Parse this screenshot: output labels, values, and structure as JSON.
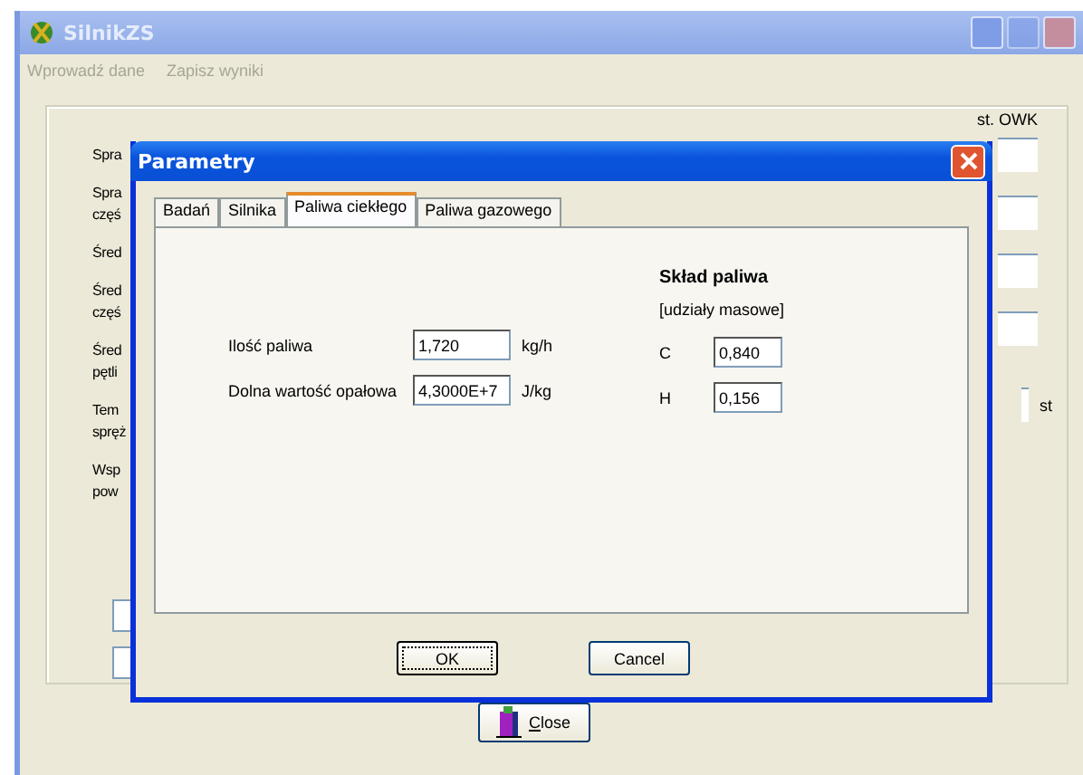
{
  "main_window": {
    "title": "SilnikZS",
    "menu": [
      {
        "label": "Wprowadź dane",
        "disabled": true
      },
      {
        "label": "Zapisz wyniki",
        "disabled": true
      }
    ],
    "labels": [
      {
        "lines": [
          "Spra"
        ]
      },
      {
        "lines": [
          "Spra",
          "częś"
        ]
      },
      {
        "lines": [
          "Śred"
        ]
      },
      {
        "lines": [
          "Śred",
          "częś"
        ]
      },
      {
        "lines": [
          "Śred",
          "pętli"
        ]
      },
      {
        "lines": [
          "Tem",
          "spręż"
        ]
      },
      {
        "lines": [
          "Wsp",
          "pow"
        ]
      }
    ],
    "unit_header": "st. OWK",
    "unit_label": "st",
    "close_button": "Close"
  },
  "dialog": {
    "title": "Parametry",
    "tabs": [
      {
        "label": "Badań",
        "selected": false
      },
      {
        "label": "Silnika",
        "selected": false
      },
      {
        "label": "Paliwa ciekłego",
        "selected": true
      },
      {
        "label": "Paliwa gazowego",
        "selected": false
      }
    ],
    "fields": [
      {
        "label": "Ilość paliwa",
        "value": "1,720",
        "unit": "kg/h"
      },
      {
        "label": "Dolna wartość opałowa",
        "value": "4,3000E+7",
        "unit": "J/kg"
      }
    ],
    "composition": {
      "title": "Skład paliwa",
      "subtitle": "[udziały masowe]",
      "fields": [
        {
          "label": "C",
          "value": "0,840"
        },
        {
          "label": "H",
          "value": "0,156"
        }
      ]
    },
    "buttons": [
      {
        "label": "OK",
        "default": true
      },
      {
        "label": "Cancel",
        "default": false
      }
    ]
  }
}
